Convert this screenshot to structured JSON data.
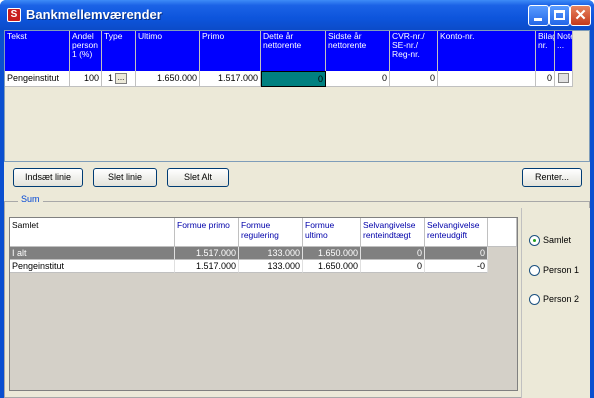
{
  "window": {
    "title": "Bankmellemværender",
    "app_icon_letter": "S"
  },
  "grid": {
    "headers": [
      "Tekst",
      "Andel person 1 (%)",
      "Type",
      "Ultimo",
      "Primo",
      "Dette år nettorente",
      "Sidste år nettorente",
      "CVR-nr./ SE-nr./ Reg-nr.",
      "Konto-nr.",
      "Bilag nr.",
      "Note"
    ],
    "note_dots": "...",
    "row": {
      "tekst": "Pengeinstitut",
      "andel": "100",
      "type": "1",
      "type_button": "...",
      "ultimo": "1.650.000",
      "primo": "1.517.000",
      "dette_aar": "0",
      "sidste_aar": "0",
      "cvr": "0",
      "konto": "",
      "bilag": "0"
    }
  },
  "buttons": {
    "insert": "Indsæt linie",
    "delete": "Slet linie",
    "delete_all": "Slet Alt",
    "rates": "Renter..."
  },
  "sum": {
    "legend": "Sum",
    "headers": [
      "Samlet",
      "Formue primo",
      "Formue regulering",
      "Formue ultimo",
      "Selvangivelse renteindtægt",
      "Selvangivelse renteudgift"
    ],
    "rows": [
      {
        "label": "I alt",
        "primo": "1.517.000",
        "regulering": "133.000",
        "ultimo": "1.650.000",
        "indtaegt": "0",
        "udgift": "0"
      },
      {
        "label": "Pengeinstitut",
        "primo": "1.517.000",
        "regulering": "133.000",
        "ultimo": "1.650.000",
        "indtaegt": "0",
        "udgift": "-0"
      }
    ]
  },
  "radios": [
    {
      "label": "Samlet",
      "checked": true
    },
    {
      "label": "Person 1",
      "checked": false
    },
    {
      "label": "Person 2",
      "checked": false
    }
  ],
  "colors": {
    "header_blue": "#0000ff",
    "selected_cell": "#008080",
    "titlebar": "#0b4bc8"
  }
}
